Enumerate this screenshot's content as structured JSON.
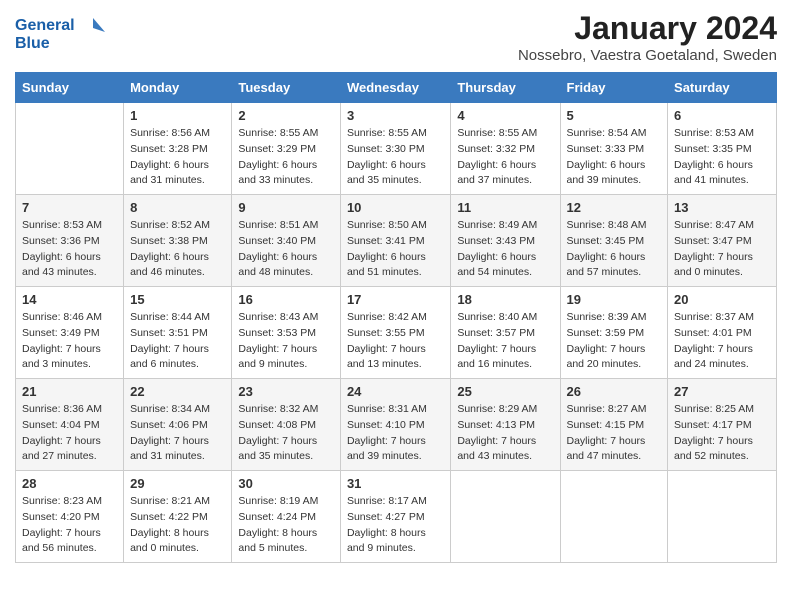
{
  "header": {
    "logo_general": "General",
    "logo_blue": "Blue",
    "title": "January 2024",
    "subtitle": "Nossebro, Vaestra Goetaland, Sweden"
  },
  "calendar": {
    "days_of_week": [
      "Sunday",
      "Monday",
      "Tuesday",
      "Wednesday",
      "Thursday",
      "Friday",
      "Saturday"
    ],
    "weeks": [
      [
        {
          "day": "",
          "sunrise": "",
          "sunset": "",
          "daylight": ""
        },
        {
          "day": "1",
          "sunrise": "Sunrise: 8:56 AM",
          "sunset": "Sunset: 3:28 PM",
          "daylight": "Daylight: 6 hours and 31 minutes."
        },
        {
          "day": "2",
          "sunrise": "Sunrise: 8:55 AM",
          "sunset": "Sunset: 3:29 PM",
          "daylight": "Daylight: 6 hours and 33 minutes."
        },
        {
          "day": "3",
          "sunrise": "Sunrise: 8:55 AM",
          "sunset": "Sunset: 3:30 PM",
          "daylight": "Daylight: 6 hours and 35 minutes."
        },
        {
          "day": "4",
          "sunrise": "Sunrise: 8:55 AM",
          "sunset": "Sunset: 3:32 PM",
          "daylight": "Daylight: 6 hours and 37 minutes."
        },
        {
          "day": "5",
          "sunrise": "Sunrise: 8:54 AM",
          "sunset": "Sunset: 3:33 PM",
          "daylight": "Daylight: 6 hours and 39 minutes."
        },
        {
          "day": "6",
          "sunrise": "Sunrise: 8:53 AM",
          "sunset": "Sunset: 3:35 PM",
          "daylight": "Daylight: 6 hours and 41 minutes."
        }
      ],
      [
        {
          "day": "7",
          "sunrise": "Sunrise: 8:53 AM",
          "sunset": "Sunset: 3:36 PM",
          "daylight": "Daylight: 6 hours and 43 minutes."
        },
        {
          "day": "8",
          "sunrise": "Sunrise: 8:52 AM",
          "sunset": "Sunset: 3:38 PM",
          "daylight": "Daylight: 6 hours and 46 minutes."
        },
        {
          "day": "9",
          "sunrise": "Sunrise: 8:51 AM",
          "sunset": "Sunset: 3:40 PM",
          "daylight": "Daylight: 6 hours and 48 minutes."
        },
        {
          "day": "10",
          "sunrise": "Sunrise: 8:50 AM",
          "sunset": "Sunset: 3:41 PM",
          "daylight": "Daylight: 6 hours and 51 minutes."
        },
        {
          "day": "11",
          "sunrise": "Sunrise: 8:49 AM",
          "sunset": "Sunset: 3:43 PM",
          "daylight": "Daylight: 6 hours and 54 minutes."
        },
        {
          "day": "12",
          "sunrise": "Sunrise: 8:48 AM",
          "sunset": "Sunset: 3:45 PM",
          "daylight": "Daylight: 6 hours and 57 minutes."
        },
        {
          "day": "13",
          "sunrise": "Sunrise: 8:47 AM",
          "sunset": "Sunset: 3:47 PM",
          "daylight": "Daylight: 7 hours and 0 minutes."
        }
      ],
      [
        {
          "day": "14",
          "sunrise": "Sunrise: 8:46 AM",
          "sunset": "Sunset: 3:49 PM",
          "daylight": "Daylight: 7 hours and 3 minutes."
        },
        {
          "day": "15",
          "sunrise": "Sunrise: 8:44 AM",
          "sunset": "Sunset: 3:51 PM",
          "daylight": "Daylight: 7 hours and 6 minutes."
        },
        {
          "day": "16",
          "sunrise": "Sunrise: 8:43 AM",
          "sunset": "Sunset: 3:53 PM",
          "daylight": "Daylight: 7 hours and 9 minutes."
        },
        {
          "day": "17",
          "sunrise": "Sunrise: 8:42 AM",
          "sunset": "Sunset: 3:55 PM",
          "daylight": "Daylight: 7 hours and 13 minutes."
        },
        {
          "day": "18",
          "sunrise": "Sunrise: 8:40 AM",
          "sunset": "Sunset: 3:57 PM",
          "daylight": "Daylight: 7 hours and 16 minutes."
        },
        {
          "day": "19",
          "sunrise": "Sunrise: 8:39 AM",
          "sunset": "Sunset: 3:59 PM",
          "daylight": "Daylight: 7 hours and 20 minutes."
        },
        {
          "day": "20",
          "sunrise": "Sunrise: 8:37 AM",
          "sunset": "Sunset: 4:01 PM",
          "daylight": "Daylight: 7 hours and 24 minutes."
        }
      ],
      [
        {
          "day": "21",
          "sunrise": "Sunrise: 8:36 AM",
          "sunset": "Sunset: 4:04 PM",
          "daylight": "Daylight: 7 hours and 27 minutes."
        },
        {
          "day": "22",
          "sunrise": "Sunrise: 8:34 AM",
          "sunset": "Sunset: 4:06 PM",
          "daylight": "Daylight: 7 hours and 31 minutes."
        },
        {
          "day": "23",
          "sunrise": "Sunrise: 8:32 AM",
          "sunset": "Sunset: 4:08 PM",
          "daylight": "Daylight: 7 hours and 35 minutes."
        },
        {
          "day": "24",
          "sunrise": "Sunrise: 8:31 AM",
          "sunset": "Sunset: 4:10 PM",
          "daylight": "Daylight: 7 hours and 39 minutes."
        },
        {
          "day": "25",
          "sunrise": "Sunrise: 8:29 AM",
          "sunset": "Sunset: 4:13 PM",
          "daylight": "Daylight: 7 hours and 43 minutes."
        },
        {
          "day": "26",
          "sunrise": "Sunrise: 8:27 AM",
          "sunset": "Sunset: 4:15 PM",
          "daylight": "Daylight: 7 hours and 47 minutes."
        },
        {
          "day": "27",
          "sunrise": "Sunrise: 8:25 AM",
          "sunset": "Sunset: 4:17 PM",
          "daylight": "Daylight: 7 hours and 52 minutes."
        }
      ],
      [
        {
          "day": "28",
          "sunrise": "Sunrise: 8:23 AM",
          "sunset": "Sunset: 4:20 PM",
          "daylight": "Daylight: 7 hours and 56 minutes."
        },
        {
          "day": "29",
          "sunrise": "Sunrise: 8:21 AM",
          "sunset": "Sunset: 4:22 PM",
          "daylight": "Daylight: 8 hours and 0 minutes."
        },
        {
          "day": "30",
          "sunrise": "Sunrise: 8:19 AM",
          "sunset": "Sunset: 4:24 PM",
          "daylight": "Daylight: 8 hours and 5 minutes."
        },
        {
          "day": "31",
          "sunrise": "Sunrise: 8:17 AM",
          "sunset": "Sunset: 4:27 PM",
          "daylight": "Daylight: 8 hours and 9 minutes."
        },
        {
          "day": "",
          "sunrise": "",
          "sunset": "",
          "daylight": ""
        },
        {
          "day": "",
          "sunrise": "",
          "sunset": "",
          "daylight": ""
        },
        {
          "day": "",
          "sunrise": "",
          "sunset": "",
          "daylight": ""
        }
      ]
    ]
  }
}
